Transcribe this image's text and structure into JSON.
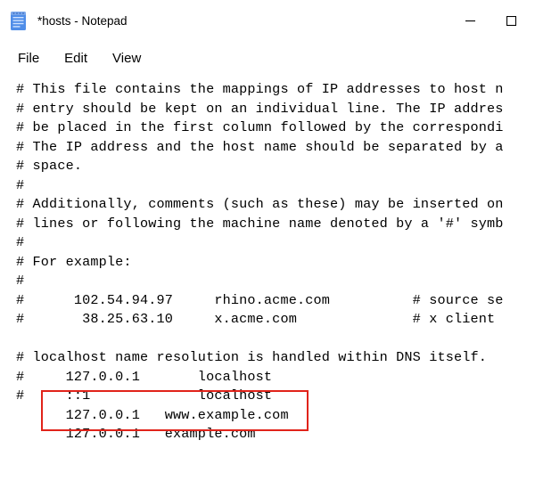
{
  "titlebar": {
    "title": "*hosts - Notepad"
  },
  "menubar": {
    "file": "File",
    "edit": "Edit",
    "view": "View"
  },
  "editor": {
    "content": "# This file contains the mappings of IP addresses to host n\n# entry should be kept on an individual line. The IP addres\n# be placed in the first column followed by the correspondi\n# The IP address and the host name should be separated by a\n# space.\n#\n# Additionally, comments (such as these) may be inserted on\n# lines or following the machine name denoted by a '#' symb\n#\n# For example:\n#\n#      102.54.94.97     rhino.acme.com          # source se\n#       38.25.63.10     x.acme.com              # x client \n\n# localhost name resolution is handled within DNS itself.\n#     127.0.0.1       localhost\n#     ::1             localhost\n      127.0.0.1   www.example.com\n      127.0.0.1   example.com"
  }
}
